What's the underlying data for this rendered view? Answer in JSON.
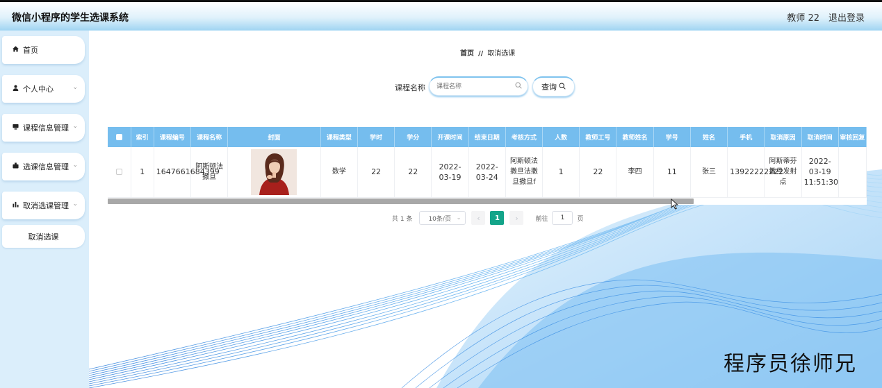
{
  "app": {
    "title": "微信小程序的学生选课系统",
    "user": "教师 22",
    "logout": "退出登录"
  },
  "sidebar": {
    "items": [
      {
        "label": "首页",
        "icon": "home-icon"
      },
      {
        "label": "个人中心",
        "icon": "user-icon"
      },
      {
        "label": "课程信息管理",
        "icon": "monitor-icon"
      },
      {
        "label": "选课信息管理",
        "icon": "id-card-icon"
      },
      {
        "label": "取消选课管理",
        "icon": "bar-chart-icon"
      }
    ],
    "subitem": "取消选课"
  },
  "breadcrumb": {
    "home": "首页",
    "separator": "//",
    "current": "取消选课"
  },
  "search": {
    "label": "课程名称",
    "placeholder": "课程名称",
    "button": "查询"
  },
  "table": {
    "headers": [
      "索引",
      "课程编号",
      "课程名称",
      "封面",
      "课程类型",
      "学时",
      "学分",
      "开课时间",
      "结束日期",
      "考核方式",
      "人数",
      "教师工号",
      "教师姓名",
      "学号",
      "姓名",
      "手机",
      "取消原因",
      "取消时间",
      "审核回复"
    ],
    "rows": [
      {
        "index": "1",
        "course_no": "1647661684399",
        "course_name": "阿斯顿法撒旦",
        "cover": "portrait-photo",
        "course_type": "数学",
        "hours": "22",
        "credits": "22",
        "start_time": "2022-03-19",
        "end_date": "2022-03-24",
        "assessment": "阿斯顿法撒旦法撒旦撒旦f",
        "count": "1",
        "teacher_no": "22",
        "teacher_name": "李四",
        "student_no": "11",
        "student_name": "张三",
        "phone": "13922222222",
        "cancel_reason": "阿斯蒂芬撒旦发射点",
        "cancel_time": "2022-03-19 11:51:30",
        "review_reply": ""
      }
    ]
  },
  "pagination": {
    "total": "共 1 条",
    "page_size": "10条/页",
    "prev": "‹",
    "current_page": "1",
    "next": "›",
    "goto_label": "前往",
    "goto_value": "1",
    "page_unit": "页"
  },
  "watermark": "程序员徐师兄",
  "colors": {
    "header_bg": "#75bdee",
    "accent": "#13a489",
    "sidebar_bg": "#dbeefb"
  }
}
